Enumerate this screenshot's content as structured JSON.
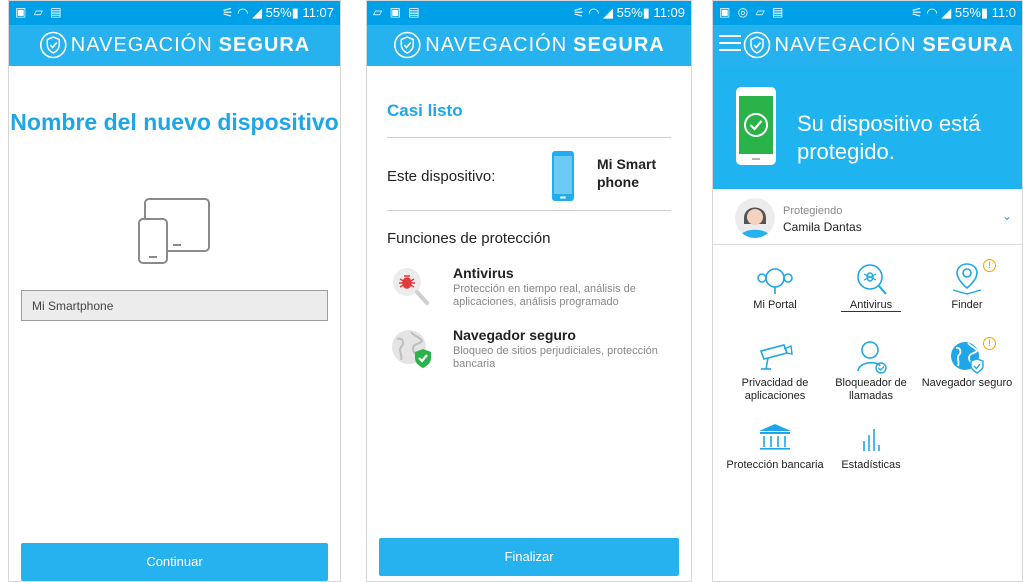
{
  "brand": {
    "light": "NAVEGACIÓN",
    "bold": "SEGURA"
  },
  "colors": {
    "primary": "#25b2ef",
    "status_bar": "#00a0e8",
    "heading": "#1ea6e8",
    "badge": "#f0a500",
    "check_green": "#2bb34a"
  },
  "screens": [
    {
      "status": {
        "left": "▣ ▱ ▤",
        "right": "⚟ ◠ ◢ 55%▮ 11:07"
      },
      "title": "Nombre del nuevo dispositivo",
      "device_icon": "tablet-phone-icon",
      "input": {
        "value": "Mi Smartphone"
      },
      "button": "Continuar"
    },
    {
      "status": {
        "left": "▱ ▣ ▤",
        "right": "⚟ ◠ ◢ 55%▮ 11:09"
      },
      "title": "Casi listo",
      "device_label": "Este dispositivo:",
      "device_name": "Mi Smart phone",
      "functions_title": "Funciones de protección",
      "features": [
        {
          "icon": "virus-search-icon",
          "title": "Antivirus",
          "desc": "Protección en tiempo real, análisis de aplicaciones, análisis programado"
        },
        {
          "icon": "globe-shield-icon",
          "title": "Navegador seguro",
          "desc": "Bloqueo de sitios perjudiciales, protección bancaria"
        }
      ],
      "button": "Finalizar"
    },
    {
      "status": {
        "left": "▣ ◎ ▱ ▤",
        "right": "⚟ ◠ ◢ 55%▮ 11:0"
      },
      "hero_text": "Su dispositivo está protegido.",
      "profile": {
        "label": "Protegiendo",
        "name": "Camila Dantas"
      },
      "grid": [
        {
          "icon": "portal-icon",
          "label": "Mi Portal"
        },
        {
          "icon": "antivirus-icon",
          "label": "Antivirus"
        },
        {
          "icon": "finder-icon",
          "label": "Finder",
          "badge": "!"
        },
        {
          "icon": "privacy-camera-icon",
          "label": "Privacidad de aplicaciones"
        },
        {
          "icon": "call-blocker-icon",
          "label": "Bloqueador de llamadas"
        },
        {
          "icon": "browser-globe-icon",
          "label": "Navegador seguro",
          "badge": "!"
        },
        {
          "icon": "bank-icon",
          "label": "Protección bancaria"
        },
        {
          "icon": "statistics-icon",
          "label": "Estadísticas"
        }
      ]
    }
  ]
}
